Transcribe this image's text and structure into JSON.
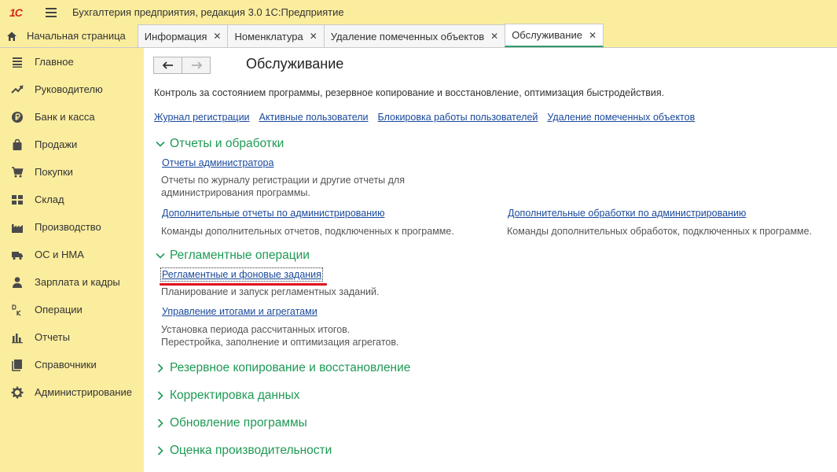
{
  "app": {
    "logo_text": "1С",
    "title": "Бухгалтерия предприятия, редакция 3.0 1С:Предприятие"
  },
  "tabs": [
    {
      "label": "Начальная страница",
      "closable": false,
      "active": false
    },
    {
      "label": "Информация",
      "closable": true,
      "active": false
    },
    {
      "label": "Номенклатура",
      "closable": true,
      "active": false
    },
    {
      "label": "Удаление помеченных объектов",
      "closable": true,
      "active": false
    },
    {
      "label": "Обслуживание",
      "closable": true,
      "active": true
    }
  ],
  "tab_close_glyph": "✕",
  "sidebar": {
    "items": [
      {
        "label": "Главное",
        "icon": "menu-lines-icon"
      },
      {
        "label": "Руководителю",
        "icon": "trend-chart-icon"
      },
      {
        "label": "Банк и касса",
        "icon": "ruble-coin-icon"
      },
      {
        "label": "Продажи",
        "icon": "shopping-bag-icon"
      },
      {
        "label": "Покупки",
        "icon": "cart-icon"
      },
      {
        "label": "Склад",
        "icon": "warehouse-grid-icon"
      },
      {
        "label": "Производство",
        "icon": "factory-icon"
      },
      {
        "label": "ОС и НМА",
        "icon": "truck-icon"
      },
      {
        "label": "Зарплата и кадры",
        "icon": "person-icon"
      },
      {
        "label": "Операции",
        "icon": "debit-credit-icon"
      },
      {
        "label": "Отчеты",
        "icon": "bar-chart-icon"
      },
      {
        "label": "Справочники",
        "icon": "books-icon"
      },
      {
        "label": "Администрирование",
        "icon": "gear-icon"
      }
    ]
  },
  "main": {
    "title": "Обслуживание",
    "description": "Контроль за состоянием программы, резервное копирование и восстановление, оптимизация быстродействия.",
    "top_links": [
      "Журнал регистрации",
      "Активные пользователи",
      "Блокировка работы пользователей",
      "Удаление помеченных объектов"
    ],
    "groups": {
      "reports": {
        "title": "Отчеты и обработки",
        "expanded": true,
        "admin_reports_link": "Отчеты администратора",
        "admin_reports_desc_1": "Отчеты по журналу регистрации и другие отчеты для",
        "admin_reports_desc_2": "администрирования программы.",
        "extra_reports_link": "Дополнительные отчеты по администрированию",
        "extra_reports_desc": "Команды дополнительных отчетов, подключенных к программе.",
        "extra_processing_link": "Дополнительные обработки по администрированию",
        "extra_processing_desc": "Команды дополнительных обработок, подключенных к программе."
      },
      "scheduled": {
        "title": "Регламентные операции",
        "expanded": true,
        "jobs_link": "Регламентные и фоновые задания",
        "jobs_desc": "Планирование и запуск регламентных заданий.",
        "totals_link": "Управление итогами и агрегатами",
        "totals_desc_1": "Установка периода рассчитанных итогов.",
        "totals_desc_2": "Перестройка, заполнение и оптимизация агрегатов."
      },
      "backup": {
        "title": "Резервное копирование и восстановление",
        "expanded": false
      },
      "correction": {
        "title": "Корректировка данных",
        "expanded": false
      },
      "update": {
        "title": "Обновление программы",
        "expanded": false
      },
      "performance": {
        "title": "Оценка производительности",
        "expanded": false
      }
    }
  },
  "colors": {
    "sidebar_bg": "#fbed9e",
    "group_title": "#1e9a55",
    "link": "#1b4a9c",
    "active_tab_underline": "#2f9b6a",
    "annotation_red": "#e0121c"
  }
}
